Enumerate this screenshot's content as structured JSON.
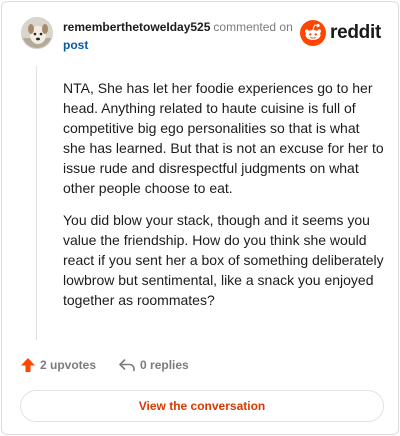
{
  "comment": {
    "username": "rememberthetoweIday525",
    "commented_text": "commented on",
    "post_link": "post",
    "paragraphs": [
      "NTA, She has let her foodie experiences go to her head. Anything related to haute cuisine is full of competitive big ego personalities so that is what she has learned. But that is not an excuse for her to issue rude and disrespectful judgments on what other people choose to eat.",
      "You did blow your stack, though and it seems you value the friendship. How do you think she would react if you sent her a box of something deliberately lowbrow but sentimental, like a snack you enjoyed together as roommates?"
    ]
  },
  "brand": {
    "name": "reddit",
    "icon": "reddit-snoo-icon",
    "color": "#ff4500"
  },
  "actions": {
    "upvotes": "2 upvotes",
    "replies": "0 replies",
    "upvote_icon": "upvote-arrow-icon",
    "reply_icon": "reply-arrow-icon",
    "upvote_color": "#ff4500"
  },
  "footer": {
    "view_label": "View the conversation",
    "accent": "#d93a00"
  }
}
